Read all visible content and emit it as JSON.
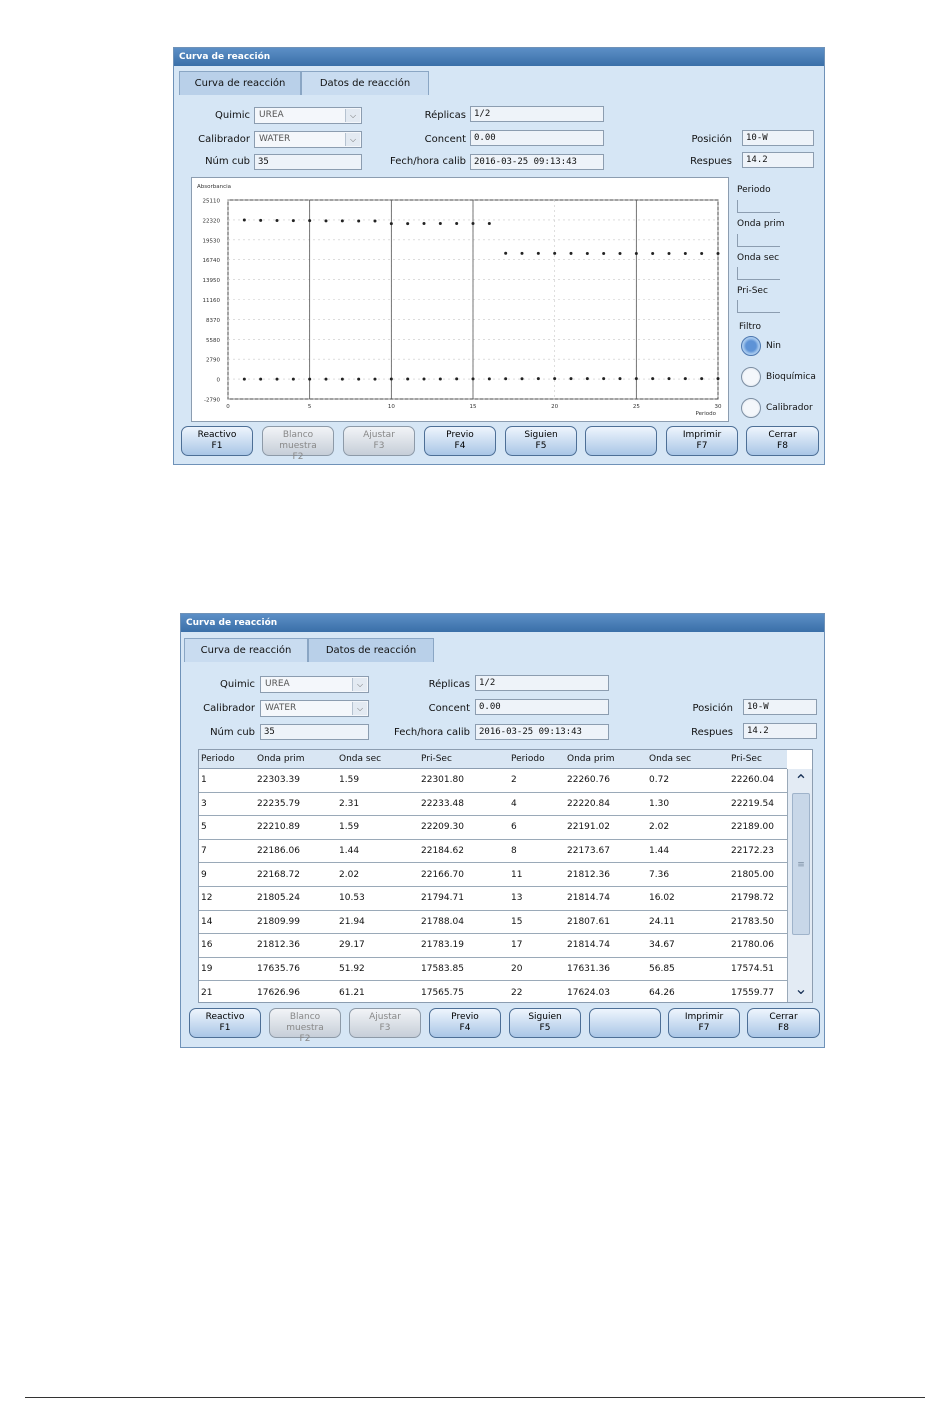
{
  "window1": {
    "title": "Curva de reacción",
    "tabs": [
      "Curva de reacción",
      "Datos de reacción"
    ],
    "form": {
      "quimic_label": "Quimic",
      "quimic_value": "UREA",
      "calibrador_label": "Calibrador",
      "calibrador_value": "WATER",
      "numcub_label": "Núm cub",
      "numcub_value": "35",
      "replicas_label": "Réplicas",
      "replicas_value": "1/2",
      "concent_label": "Concent",
      "concent_value": "0.00",
      "fecha_label": "Fech/hora calib",
      "fecha_value": "2016-03-25 09:13:43",
      "posicion_label": "Posición",
      "posicion_value": "10-W",
      "respues_label": "Respues",
      "respues_value": "14.2"
    },
    "side": {
      "periodo": "Periodo",
      "onda_prim": "Onda prim",
      "onda_sec": "Onda sec",
      "pri_sec": "Pri-Sec",
      "filtro": "Filtro",
      "options": [
        "Nin",
        "Bioquímica",
        "Calibrador"
      ]
    },
    "buttons": [
      {
        "l1": "Reactivo",
        "l2": "F1"
      },
      {
        "l1": "Blanco muestra",
        "l2": "F2"
      },
      {
        "l1": "Ajustar",
        "l2": "F3"
      },
      {
        "l1": "Previo",
        "l2": "F4"
      },
      {
        "l1": "Siguien",
        "l2": "F5"
      },
      {
        "l1": "",
        "l2": ""
      },
      {
        "l1": "Imprimir",
        "l2": "F7"
      },
      {
        "l1": "Cerrar",
        "l2": "F8"
      }
    ]
  },
  "chart_data": {
    "type": "scatter",
    "title": "",
    "ylabel": "Absorbancia",
    "xlabel": "Periodo",
    "xlim": [
      0,
      30
    ],
    "ylim": [
      -2790,
      25110
    ],
    "x_ticks": [
      0,
      5,
      10,
      15,
      20,
      25,
      30
    ],
    "y_ticks": [
      -2790,
      0,
      2790,
      5580,
      8370,
      11160,
      13950,
      16740,
      19530,
      22320,
      25110
    ],
    "y_tick_labels": [
      "-2790",
      "0",
      "2790",
      "5580",
      "8370",
      "11160",
      "13950",
      "16740",
      "19530",
      "22320",
      "25110"
    ],
    "grid": true,
    "series": [
      {
        "x": [
          1,
          2,
          3,
          4,
          5,
          6,
          7,
          8,
          9,
          10,
          11,
          12,
          13,
          14,
          15,
          16,
          17,
          18,
          19,
          20,
          21,
          22,
          23,
          24,
          25,
          26,
          27,
          28,
          29,
          30
        ],
        "values": [
          22303,
          22261,
          22236,
          22221,
          22211,
          22191,
          22186,
          22174,
          22169,
          21805,
          21805,
          21812,
          21809,
          21807,
          21813,
          21815,
          17636,
          17631,
          17627,
          17624,
          17620,
          17618,
          17615,
          17613,
          17611,
          17609,
          17607,
          17605,
          17603,
          17601
        ]
      },
      {
        "x": [
          1,
          2,
          3,
          4,
          5,
          6,
          7,
          8,
          9,
          10,
          11,
          12,
          13,
          14,
          15,
          16,
          17,
          18,
          19,
          20,
          21,
          22,
          23,
          24,
          25,
          26,
          27,
          28,
          29,
          30
        ],
        "values": [
          2,
          1,
          2,
          1,
          2,
          2,
          1,
          1,
          2,
          7,
          11,
          16,
          22,
          24,
          29,
          35,
          52,
          57,
          61,
          64,
          60,
          62,
          58,
          59,
          61,
          60,
          59,
          62,
          60,
          61
        ]
      }
    ]
  },
  "window2": {
    "title": "Curva de reacción",
    "tabs": [
      "Curva de reacción",
      "Datos de reacción"
    ],
    "form": {
      "quimic_label": "Quimic",
      "quimic_value": "UREA",
      "calibrador_label": "Calibrador",
      "calibrador_value": "WATER",
      "numcub_label": "Núm cub",
      "numcub_value": "35",
      "replicas_label": "Réplicas",
      "replicas_value": "1/2",
      "concent_label": "Concent",
      "concent_value": "0.00",
      "fecha_label": "Fech/hora calib",
      "fecha_value": "2016-03-25 09:13:43",
      "posicion_label": "Posición",
      "posicion_value": "10-W",
      "respues_label": "Respues",
      "respues_value": "14.2"
    },
    "table": {
      "headers": [
        "Periodo",
        "Onda prim",
        "Onda sec",
        "Pri-Sec",
        "Periodo",
        "Onda prim",
        "Onda sec",
        "Pri-Sec"
      ],
      "rows": [
        [
          "1",
          "22303.39",
          "1.59",
          "22301.80",
          "2",
          "22260.76",
          "0.72",
          "22260.04"
        ],
        [
          "3",
          "22235.79",
          "2.31",
          "22233.48",
          "4",
          "22220.84",
          "1.30",
          "22219.54"
        ],
        [
          "5",
          "22210.89",
          "1.59",
          "22209.30",
          "6",
          "22191.02",
          "2.02",
          "22189.00"
        ],
        [
          "7",
          "22186.06",
          "1.44",
          "22184.62",
          "8",
          "22173.67",
          "1.44",
          "22172.23"
        ],
        [
          "9",
          "22168.72",
          "2.02",
          "22166.70",
          "11",
          "21812.36",
          "7.36",
          "21805.00"
        ],
        [
          "12",
          "21805.24",
          "10.53",
          "21794.71",
          "13",
          "21814.74",
          "16.02",
          "21798.72"
        ],
        [
          "14",
          "21809.99",
          "21.94",
          "21788.04",
          "15",
          "21807.61",
          "24.11",
          "21783.50"
        ],
        [
          "16",
          "21812.36",
          "29.17",
          "21783.19",
          "17",
          "21814.74",
          "34.67",
          "21780.06"
        ],
        [
          "19",
          "17635.76",
          "51.92",
          "17583.85",
          "20",
          "17631.36",
          "56.85",
          "17574.51"
        ],
        [
          "21",
          "17626.96",
          "61.21",
          "17565.75",
          "22",
          "17624.03",
          "64.26",
          "17559.77"
        ]
      ]
    },
    "buttons": [
      {
        "l1": "Reactivo",
        "l2": "F1"
      },
      {
        "l1": "Blanco muestra",
        "l2": "F2"
      },
      {
        "l1": "Ajustar",
        "l2": "F3"
      },
      {
        "l1": "Previo",
        "l2": "F4"
      },
      {
        "l1": "Siguien",
        "l2": "F5"
      },
      {
        "l1": "",
        "l2": ""
      },
      {
        "l1": "Imprimir",
        "l2": "F7"
      },
      {
        "l1": "Cerrar",
        "l2": "F8"
      }
    ]
  }
}
